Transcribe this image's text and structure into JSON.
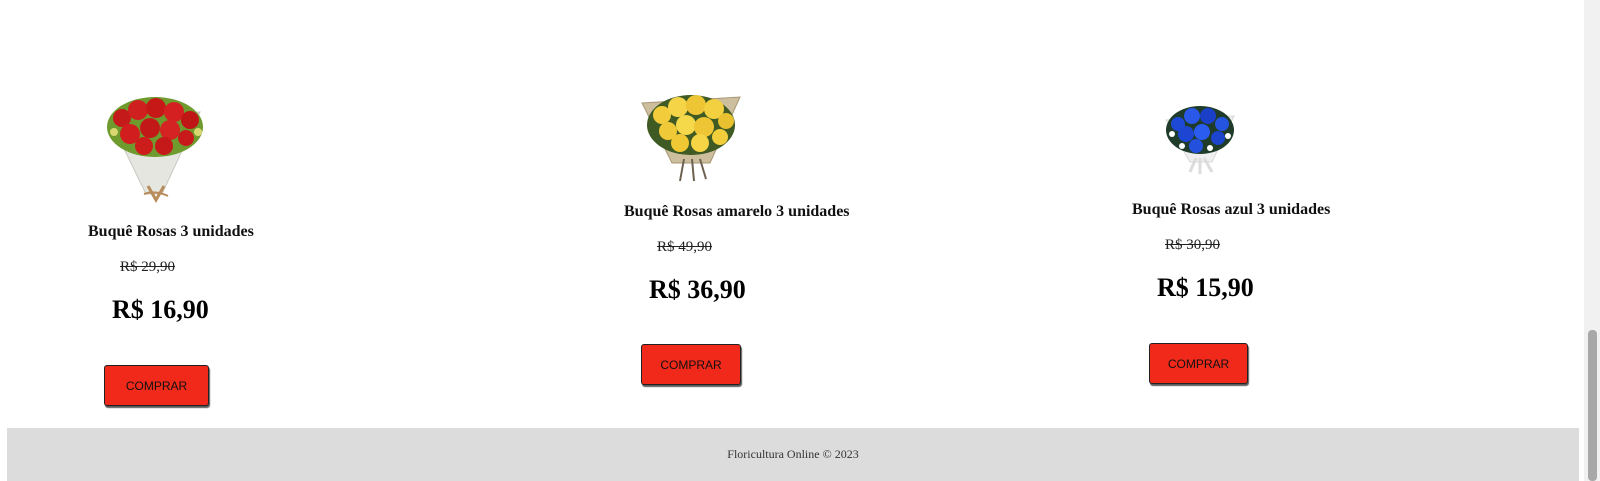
{
  "products": [
    {
      "name": "Buquê Rosas 3 unidades",
      "old_price": "R$ 29,90",
      "price": "R$ 16,90",
      "buy_label": "COMPRAR",
      "image": "red-rose-bouquet"
    },
    {
      "name": "Buquê Rosas amarelo 3 unidades",
      "old_price": "R$ 49,90",
      "price": "R$ 36,90",
      "buy_label": "COMPRAR",
      "image": "yellow-rose-bouquet"
    },
    {
      "name": "Buquê Rosas azul 3 unidades",
      "old_price": "R$ 30,90",
      "price": "R$ 15,90",
      "buy_label": "COMPRAR",
      "image": "blue-rose-bouquet"
    }
  ],
  "footer": {
    "text": "Floricultura Online © 2023"
  },
  "colors": {
    "buy_button": "#f1291a",
    "footer_bg": "#dcdcdc"
  }
}
